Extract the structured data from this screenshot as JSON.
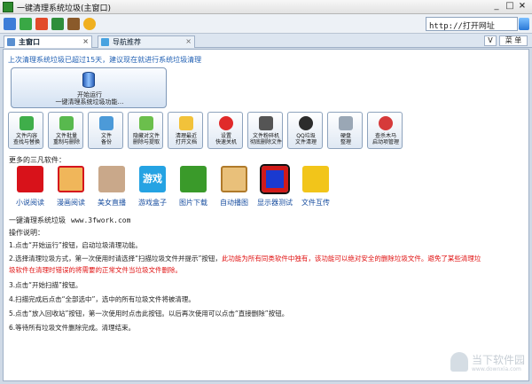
{
  "window": {
    "title": "一键清理系统垃圾(主窗口)",
    "min": "_",
    "max": "□",
    "close": "×"
  },
  "toolbar": {
    "icons": [
      "home-icon",
      "refresh-icon",
      "shop-icon",
      "game-icon",
      "person-icon",
      "chat-icon"
    ],
    "url_value": "http://打开网址"
  },
  "tabs": [
    {
      "label": "主窗口",
      "close": "×"
    },
    {
      "label": "导航推荐",
      "close": "×"
    }
  ],
  "tab_controls": {
    "v": "V",
    "menu": "菜 单"
  },
  "notice": "上次清理系统垃圾已超过15天，建议现在就进行系统垃圾清理",
  "main_button": {
    "line1": "开始运行",
    "line2": "一键清理系统垃圾功能…"
  },
  "tools": [
    {
      "line1": "文件内容",
      "line2": "查找与替换"
    },
    {
      "line1": "文件批量",
      "line2": "重制与删除"
    },
    {
      "line1": "文件",
      "line2": "备份"
    },
    {
      "line1": "隐藏对文件",
      "line2": "删除与提取"
    },
    {
      "line1": "清理最近",
      "line2": "打开文档"
    },
    {
      "line1": "设置",
      "line2": "快速关机"
    },
    {
      "line1": "文件粉碎机",
      "line2": "彻底删除文件"
    },
    {
      "line1": "QQ垃圾",
      "line2": "文件清理"
    },
    {
      "line1": "硬盘",
      "line2": "整理"
    },
    {
      "line1": "查杀木马",
      "line2": "启动项管理"
    }
  ],
  "more_label": "更多的三凡软件：",
  "apps": [
    {
      "label": "小说阅读",
      "icon": "novel-icon"
    },
    {
      "label": "漫画阅读",
      "icon": "comic-icon"
    },
    {
      "label": "美女直播",
      "icon": "live-icon"
    },
    {
      "label": "游戏盒子",
      "icon": "game-box-icon",
      "icon_text": "游戏"
    },
    {
      "label": "图片下载",
      "icon": "image-download-icon"
    },
    {
      "label": "自动播图",
      "icon": "slideshow-icon"
    },
    {
      "label": "显示器测试",
      "icon": "monitor-test-icon"
    },
    {
      "label": "文件互传",
      "icon": "file-transfer-icon"
    }
  ],
  "site": {
    "name": "一键清理系统垃圾",
    "url": "www.3fwork.com"
  },
  "instructions": {
    "title": "操作说明：",
    "step1": "1.点击“开始运行”按钮，启动垃圾清理功能。",
    "step2a": "2.选择清理垃圾方式，第一次使用时请选择“扫描垃圾文件并提示”按钮，",
    "step2b": "此功能为所有同类软件中独有，该功能可以绝对安全的删除垃圾文件。避免了某些清理垃",
    "step2c": "圾软件在清理时错误的将需要的正常文件当垃圾文件删除。",
    "step3": "3.点击“开始扫描”按钮。",
    "step4": "4.扫描完成后点击“全部选中”，选中的所有垃圾文件将被清理。",
    "step5": "5.点击“放入回收站”按钮，第一次使用时点击此按钮。以后再次使用可以点击“直接删除”按钮。",
    "step6": "6.等待所有垃圾文件删除完成。清理结束。"
  },
  "watermark": {
    "text": "当下软件园",
    "sub": "www.downxia.com"
  }
}
